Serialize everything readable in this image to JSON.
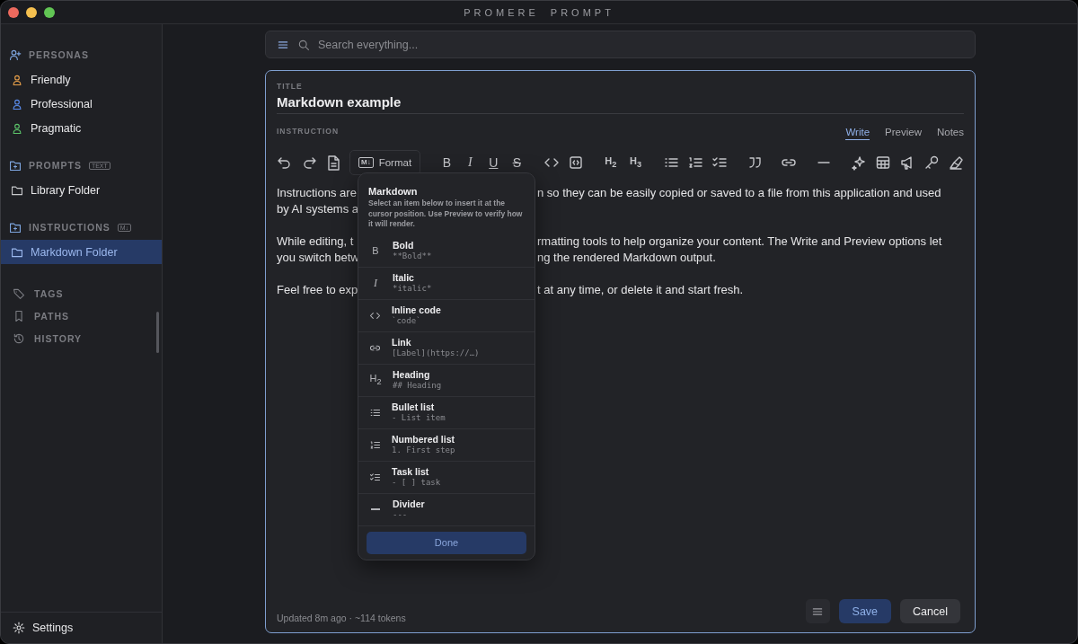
{
  "window": {
    "title": "PROMERE PROMPT"
  },
  "sidebar": {
    "sections": [
      {
        "kind": "personas",
        "label": "PERSONAS",
        "items": [
          {
            "label": "Friendly",
            "color": "#e8a04a",
            "selected": false
          },
          {
            "label": "Professional",
            "color": "#5b8def",
            "selected": false
          },
          {
            "label": "Pragmatic",
            "color": "#5cc46a",
            "selected": false
          }
        ]
      },
      {
        "kind": "folders",
        "label": "PROMPTS",
        "badge": "TEXT",
        "items": [
          {
            "label": "Library Folder",
            "selected": false
          }
        ]
      },
      {
        "kind": "folders",
        "label": "INSTRUCTIONS",
        "badge": "M↓",
        "items": [
          {
            "label": "Markdown Folder",
            "selected": true
          }
        ]
      }
    ],
    "links": [
      {
        "kind": "tag",
        "label": "TAGS"
      },
      {
        "kind": "bookmark",
        "label": "PATHS"
      },
      {
        "kind": "history",
        "label": "HISTORY"
      }
    ],
    "settings": "Settings"
  },
  "search": {
    "placeholder": "Search everything..."
  },
  "editor": {
    "title_label": "TITLE",
    "title": "Markdown example",
    "instruction_label": "INSTRUCTION",
    "tabs": [
      {
        "label": "Write",
        "selected": true
      },
      {
        "label": "Preview",
        "selected": false
      },
      {
        "label": "Notes",
        "selected": false
      }
    ],
    "format_button": "Format",
    "format_badge": "M↓",
    "style_buttons": [
      "B",
      "I",
      "U",
      "S"
    ],
    "heading_buttons": [
      "H$_{2}$",
      "H$_{3}$"
    ],
    "paragraphs": [
      [
        {
          "left": "Instructions are",
          "right": "n so they can be easily copied or saved to a file from this application and used"
        },
        {
          "left": "by AI systems a"
        }
      ],
      [
        {
          "left": "While editing, t",
          "right": "rmatting tools to help organize your content. The Write and Preview options let"
        },
        {
          "left": "you switch betw",
          "right": "ng the rendered Markdown output."
        }
      ],
      [
        {
          "left": "Feel free to exp",
          "right": "t at any time, or delete it and start fresh."
        }
      ]
    ],
    "footer": "Updated 8m ago · ~114 tokens",
    "save": "Save",
    "cancel": "Cancel"
  },
  "popup": {
    "title": "Markdown",
    "description": "Select an item below to insert it at the cursor position. Use Preview to verify how it will render.",
    "items": [
      {
        "kind": "glyph",
        "glyph": "B",
        "label": "Bold",
        "example": "**Bold**"
      },
      {
        "kind": "glyph-italic",
        "glyph": "I",
        "label": "Italic",
        "example": "*italic*"
      },
      {
        "kind": "code",
        "label": "Inline code",
        "example": "`code`"
      },
      {
        "kind": "link",
        "label": "Link",
        "example": "[Label](https://…)"
      },
      {
        "kind": "glyph",
        "glyph": "H$_{2}$",
        "label": "Heading",
        "example": "## Heading"
      },
      {
        "kind": "bullet",
        "label": "Bullet list",
        "example": "- List item"
      },
      {
        "kind": "numbered",
        "label": "Numbered list",
        "example": "1. First step"
      },
      {
        "kind": "task",
        "label": "Task list",
        "example": "- [ ] task"
      },
      {
        "kind": "divider",
        "label": "Divider",
        "example": "---"
      }
    ],
    "done": "Done"
  }
}
